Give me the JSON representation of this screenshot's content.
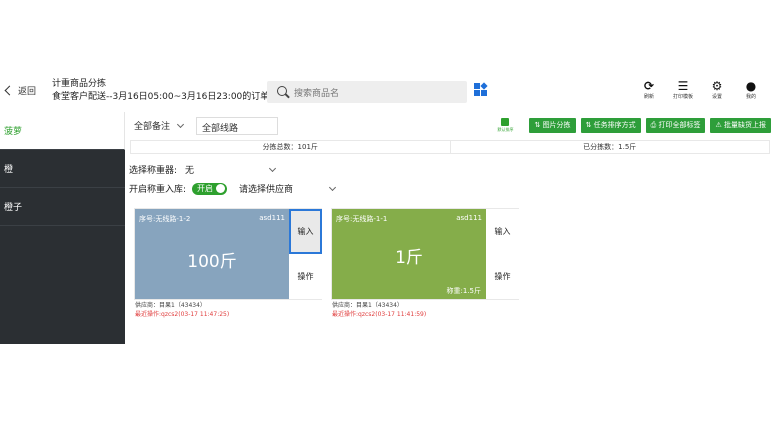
{
  "header": {
    "back_label": "返回",
    "title": "计重商品分拣",
    "subtitle": "食堂客户配送--3月16日05:00~3月16日23:00的订单",
    "search_placeholder": "搜索商品名",
    "tools": [
      {
        "icon": "refresh-icon",
        "glyph": "⟳",
        "label": "刷新"
      },
      {
        "icon": "printer-template-icon",
        "glyph": "☰",
        "label": "打印模板"
      },
      {
        "icon": "gear-icon",
        "glyph": "⚙",
        "label": "设置"
      },
      {
        "icon": "user-icon",
        "glyph": "●",
        "label": "我的"
      }
    ]
  },
  "sidebar": {
    "items": [
      {
        "label": "菠萝",
        "active": true
      },
      {
        "label": "橙",
        "active": false
      },
      {
        "label": "橙子",
        "active": false
      }
    ]
  },
  "filters": {
    "note_select": "全部备注",
    "route_value": "全部线路",
    "mini_button_label": "默认排序",
    "buttons": [
      "图片分拣",
      "任务排序方式",
      "打印全部标签",
      "批量缺货上报"
    ]
  },
  "stats": {
    "sort_count": "分拣总数：101斤",
    "sorted": "已分拣数：1.5斤"
  },
  "options": {
    "scale_label": "选择称重器:",
    "scale_value": "无",
    "weigh_in_label": "开启称重入库:",
    "toggle_label": "开启",
    "supplier_placeholder": "请选择供应商"
  },
  "cards": [
    {
      "seq": "序号:无线路-1-2",
      "code": "asd111",
      "qty": "100斤",
      "weighed": "",
      "input_label": "输入",
      "action_label": "操作",
      "supplier": "供应商：目果1（43434）",
      "recent": "最近操作:qzcs2(03-17 11:47:25)",
      "color": "#87a4be"
    },
    {
      "seq": "序号:无线路-1-1",
      "code": "asd111",
      "qty": "1斤",
      "weighed": "称重:1.5斤",
      "input_label": "输入",
      "action_label": "操作",
      "supplier": "供应商：目果1（43434）",
      "recent": "最近操作:qzcs2(03-17 11:41:59)",
      "color": "#85ad4a"
    }
  ],
  "colors": {
    "accent_green": "#2ea02e",
    "sidebar_bg": "#2b2f33",
    "selected_border": "#2b78d8",
    "recent_red": "#e03c3c"
  }
}
